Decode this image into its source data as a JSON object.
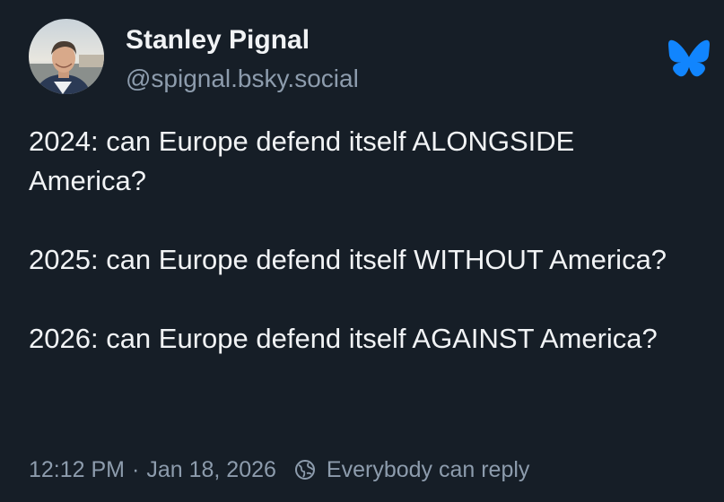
{
  "author": {
    "display_name": "Stanley Pignal",
    "handle": "@spignal.bsky.social",
    "avatar": "avatar-photo"
  },
  "brand": {
    "logo_icon": "bluesky-butterfly-icon",
    "color": "#1185fe"
  },
  "post": {
    "paragraphs": [
      "2024: can Europe defend itself ALONGSIDE America?",
      "2025: can Europe defend itself WITHOUT America?",
      "2026: can Europe defend itself AGAINST America?"
    ]
  },
  "footer": {
    "time": "12:12 PM",
    "separator": "·",
    "date": "Jan 18, 2026",
    "reply_icon": "globe-icon",
    "reply_setting": "Everybody can reply"
  },
  "colors": {
    "background": "#161e27",
    "text": "#f1f3f5",
    "muted": "#8d9cad"
  }
}
